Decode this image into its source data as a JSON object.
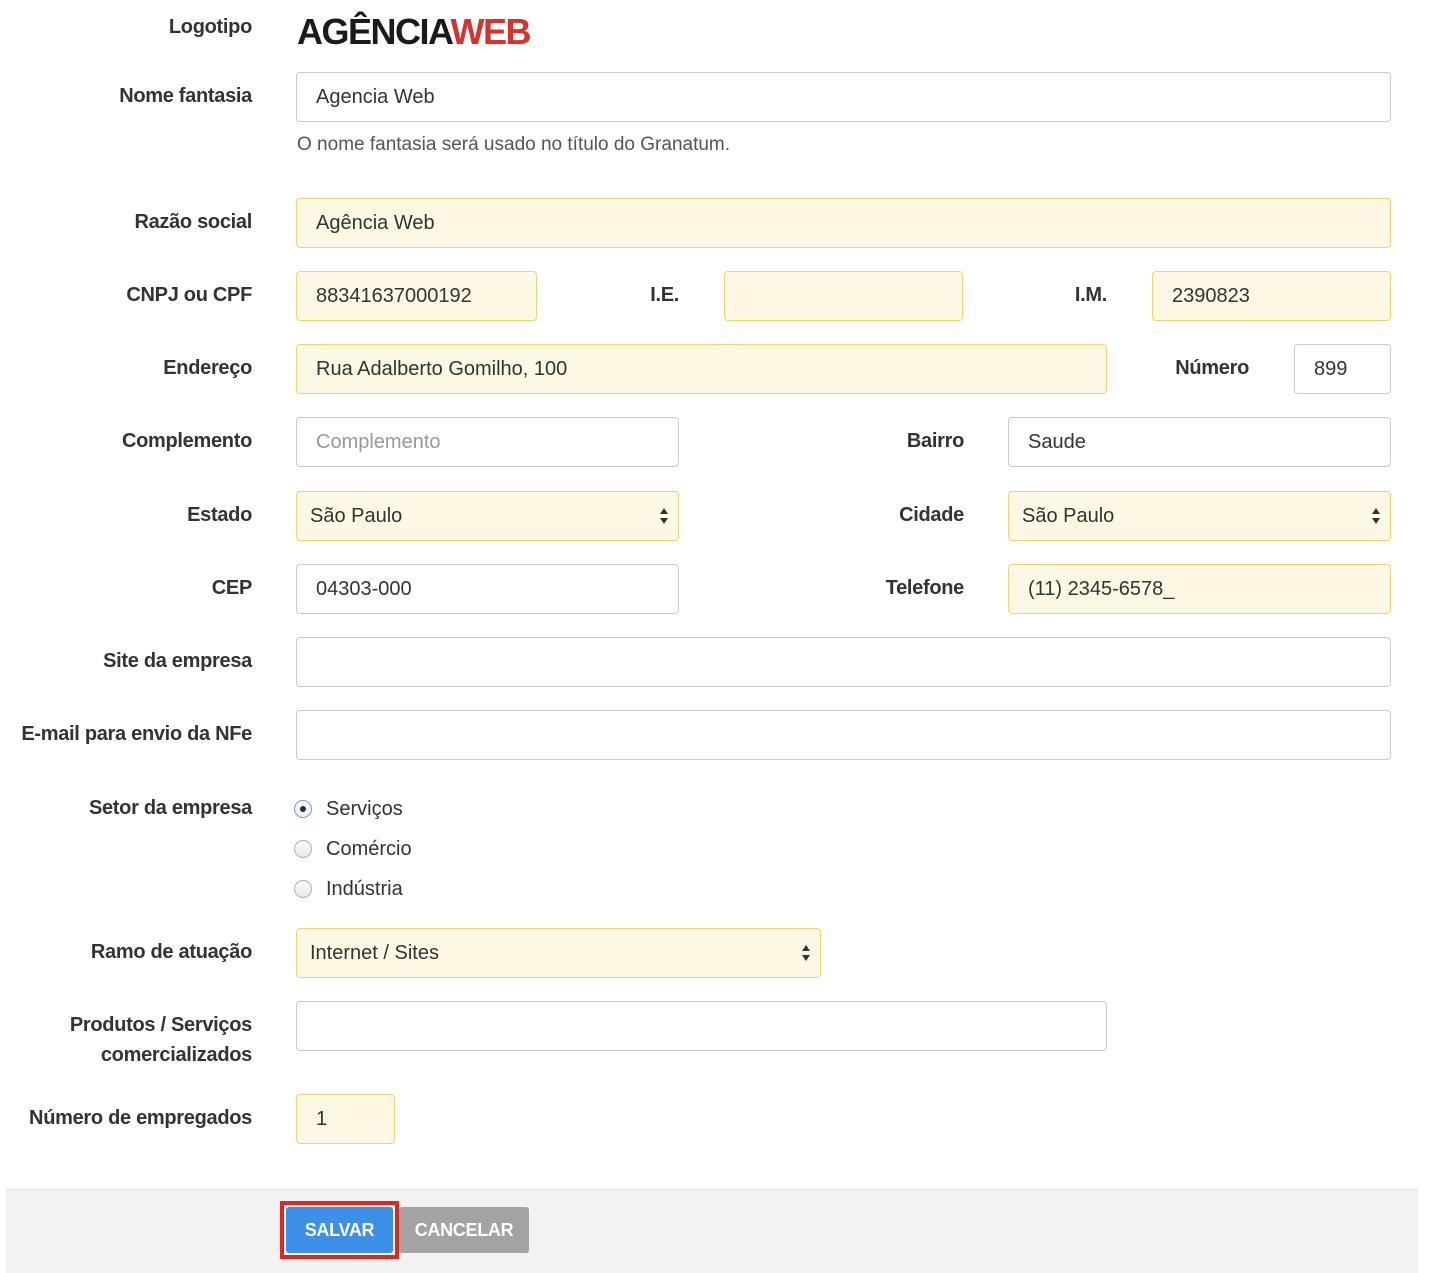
{
  "labels": {
    "logo": "Logotipo",
    "nome_fantasia": "Nome fantasia",
    "razao_social": "Razão social",
    "cnpj": "CNPJ ou CPF",
    "ie": "I.E.",
    "im": "I.M.",
    "endereco": "Endereço",
    "numero": "Número",
    "complemento": "Complemento",
    "bairro": "Bairro",
    "estado": "Estado",
    "cidade": "Cidade",
    "cep": "CEP",
    "telefone": "Telefone",
    "site": "Site da empresa",
    "email_nfe": "E-mail para envio da NFe",
    "setor": "Setor da empresa",
    "ramo": "Ramo de atuação",
    "produtos_line1": "Produtos / Serviços",
    "produtos_line2": "comercializados",
    "empregados": "Número de empregados"
  },
  "logo": {
    "part1": "AGÊNCIA",
    "part2": "WEB",
    "color1": "#1a1a1a",
    "color2": "#d9312b"
  },
  "fields": {
    "nome_fantasia": "Agencia Web",
    "nome_fantasia_help": "O nome fantasia será usado no título do Granatum.",
    "razao_social": "Agência Web",
    "cnpj": "88341637000192",
    "ie": "",
    "im": "2390823",
    "endereco": "Rua Adalberto Gomilho, 100",
    "numero": "899",
    "complemento": "",
    "complemento_placeholder": "Complemento",
    "bairro": "Saude",
    "estado": "São Paulo",
    "cidade": "São Paulo",
    "cep": "04303-000",
    "telefone": "(11) 2345-6578_",
    "site": "",
    "email_nfe": "",
    "ramo": "Internet / Sites",
    "produtos": "",
    "empregados": "1"
  },
  "setor_options": [
    {
      "label": "Serviços",
      "selected": true
    },
    {
      "label": "Comércio",
      "selected": false
    },
    {
      "label": "Indústria",
      "selected": false
    }
  ],
  "buttons": {
    "save": "SALVAR",
    "cancel": "CANCELAR"
  },
  "colors": {
    "highlight_bg": "#fcf8e3",
    "highlight_border": "#f0d277",
    "save_bg": "#3d8fe8",
    "cancel_bg": "#a3a3a3",
    "focus_outline": "#e0271f"
  }
}
